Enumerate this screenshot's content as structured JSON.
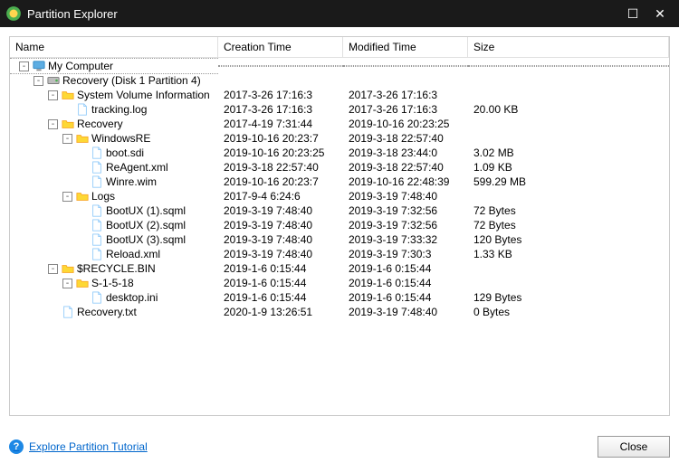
{
  "window": {
    "title": "Partition Explorer"
  },
  "columns": {
    "name": "Name",
    "ctime": "Creation Time",
    "mtime": "Modified Time",
    "size": "Size"
  },
  "footer": {
    "link": "Explore Partition Tutorial",
    "close": "Close"
  },
  "rows": [
    {
      "depth": 0,
      "expand": "-",
      "icon": "computer",
      "name": "My Computer",
      "ctime": "",
      "mtime": "",
      "size": ""
    },
    {
      "depth": 1,
      "expand": "-",
      "icon": "disk",
      "name": "Recovery (Disk 1 Partition 4)",
      "ctime": "",
      "mtime": "",
      "size": ""
    },
    {
      "depth": 2,
      "expand": "-",
      "icon": "folder",
      "name": "System Volume Information",
      "ctime": "2017-3-26 17:16:3",
      "mtime": "2017-3-26 17:16:3",
      "size": ""
    },
    {
      "depth": 3,
      "expand": "",
      "icon": "file",
      "name": "tracking.log",
      "ctime": "2017-3-26 17:16:3",
      "mtime": "2017-3-26 17:16:3",
      "size": "20.00 KB"
    },
    {
      "depth": 2,
      "expand": "-",
      "icon": "folder",
      "name": "Recovery",
      "ctime": "2017-4-19 7:31:44",
      "mtime": "2019-10-16 20:23:25",
      "size": ""
    },
    {
      "depth": 3,
      "expand": "-",
      "icon": "folder",
      "name": "WindowsRE",
      "ctime": "2019-10-16 20:23:7",
      "mtime": "2019-3-18 22:57:40",
      "size": ""
    },
    {
      "depth": 4,
      "expand": "",
      "icon": "file",
      "name": "boot.sdi",
      "ctime": "2019-10-16 20:23:25",
      "mtime": "2019-3-18 23:44:0",
      "size": "3.02 MB"
    },
    {
      "depth": 4,
      "expand": "",
      "icon": "file",
      "name": "ReAgent.xml",
      "ctime": "2019-3-18 22:57:40",
      "mtime": "2019-3-18 22:57:40",
      "size": "1.09 KB"
    },
    {
      "depth": 4,
      "expand": "",
      "icon": "file",
      "name": "Winre.wim",
      "ctime": "2019-10-16 20:23:7",
      "mtime": "2019-10-16 22:48:39",
      "size": "599.29 MB"
    },
    {
      "depth": 3,
      "expand": "-",
      "icon": "folder",
      "name": "Logs",
      "ctime": "2017-9-4 6:24:6",
      "mtime": "2019-3-19 7:48:40",
      "size": ""
    },
    {
      "depth": 4,
      "expand": "",
      "icon": "file",
      "name": "BootUX (1).sqml",
      "ctime": "2019-3-19 7:48:40",
      "mtime": "2019-3-19 7:32:56",
      "size": "72 Bytes"
    },
    {
      "depth": 4,
      "expand": "",
      "icon": "file",
      "name": "BootUX (2).sqml",
      "ctime": "2019-3-19 7:48:40",
      "mtime": "2019-3-19 7:32:56",
      "size": "72 Bytes"
    },
    {
      "depth": 4,
      "expand": "",
      "icon": "file",
      "name": "BootUX (3).sqml",
      "ctime": "2019-3-19 7:48:40",
      "mtime": "2019-3-19 7:33:32",
      "size": "120 Bytes"
    },
    {
      "depth": 4,
      "expand": "",
      "icon": "file",
      "name": "Reload.xml",
      "ctime": "2019-3-19 7:48:40",
      "mtime": "2019-3-19 7:30:3",
      "size": "1.33 KB"
    },
    {
      "depth": 2,
      "expand": "-",
      "icon": "folder",
      "name": "$RECYCLE.BIN",
      "ctime": "2019-1-6 0:15:44",
      "mtime": "2019-1-6 0:15:44",
      "size": ""
    },
    {
      "depth": 3,
      "expand": "-",
      "icon": "folder",
      "name": "S-1-5-18",
      "ctime": "2019-1-6 0:15:44",
      "mtime": "2019-1-6 0:15:44",
      "size": ""
    },
    {
      "depth": 4,
      "expand": "",
      "icon": "file",
      "name": "desktop.ini",
      "ctime": "2019-1-6 0:15:44",
      "mtime": "2019-1-6 0:15:44",
      "size": "129 Bytes"
    },
    {
      "depth": 2,
      "expand": "",
      "icon": "file",
      "name": "Recovery.txt",
      "ctime": "2020-1-9 13:26:51",
      "mtime": "2019-3-19 7:48:40",
      "size": "0 Bytes"
    }
  ]
}
